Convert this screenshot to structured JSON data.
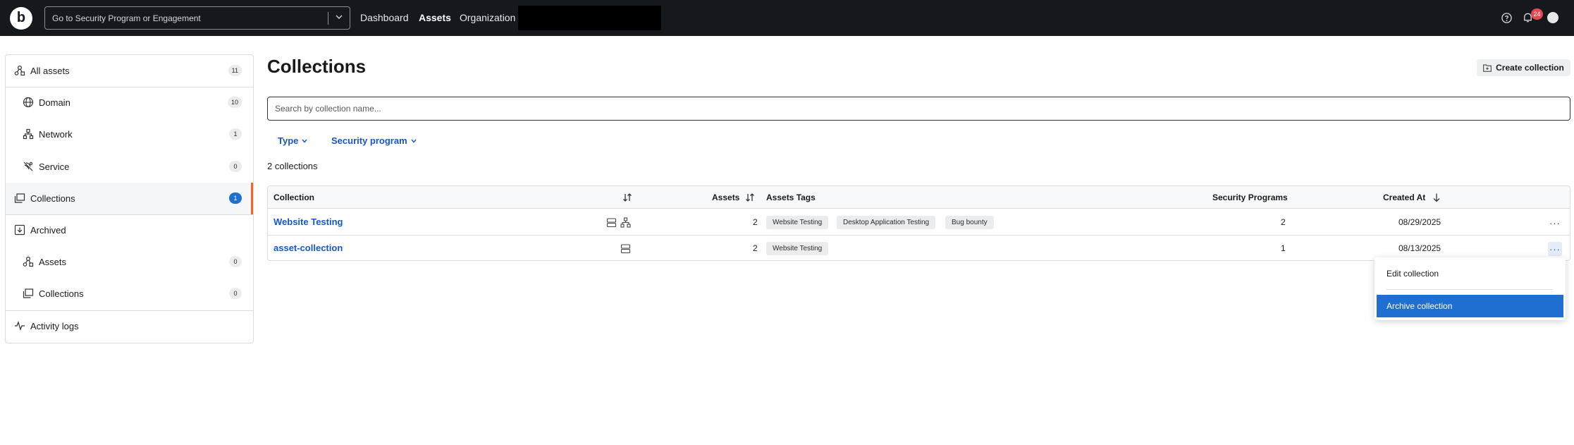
{
  "topbar": {
    "logo_letter": "b",
    "goto_placeholder": "Go to Security Program or Engagement",
    "nav": [
      "Dashboard",
      "Assets",
      "Organization"
    ],
    "active_nav": "Assets",
    "notification_count": "24"
  },
  "sidebar": {
    "items": [
      {
        "label": "All assets",
        "count": "11",
        "icon": "assets-icon"
      },
      {
        "label": "Domain",
        "count": "10",
        "icon": "globe-icon"
      },
      {
        "label": "Network",
        "count": "1",
        "icon": "network-icon"
      },
      {
        "label": "Service",
        "count": "0",
        "icon": "service-icon"
      },
      {
        "label": "Collections",
        "count": "1",
        "icon": "collections-icon"
      },
      {
        "label": "Archived",
        "icon": "archive-icon"
      },
      {
        "label": "Assets",
        "count": "0",
        "icon": "assets-icon"
      },
      {
        "label": "Collections",
        "count": "0",
        "icon": "collections-icon"
      },
      {
        "label": "Activity logs",
        "icon": "activity-icon"
      }
    ],
    "active_item": "Collections",
    "accent_color": "#f26522"
  },
  "main": {
    "title": "Collections",
    "create_button": "Create collection",
    "search_placeholder": "Search by collection name...",
    "filters": [
      "Type",
      "Security program"
    ],
    "count_text": "2 collections"
  },
  "table": {
    "headers": {
      "collection": "Collection",
      "assets": "Assets",
      "tags": "Assets Tags",
      "programs": "Security Programs",
      "created": "Created At"
    },
    "rows": [
      {
        "name": "Website Testing",
        "assets": "2",
        "tags": [
          "Website Testing",
          "Desktop Application Testing",
          "Bug bounty"
        ],
        "programs": "2",
        "created": "08/29/2025",
        "type_icons": [
          "server-icon",
          "network-icon"
        ]
      },
      {
        "name": "asset-collection",
        "assets": "2",
        "tags": [
          "Website Testing"
        ],
        "programs": "1",
        "created": "08/13/2025",
        "type_icons": [
          "server-icon"
        ]
      }
    ]
  },
  "row_menu": {
    "items": [
      "Edit collection",
      "Archive collection"
    ],
    "highlighted": "Archive collection",
    "highlight_color": "#1f6fd1"
  }
}
